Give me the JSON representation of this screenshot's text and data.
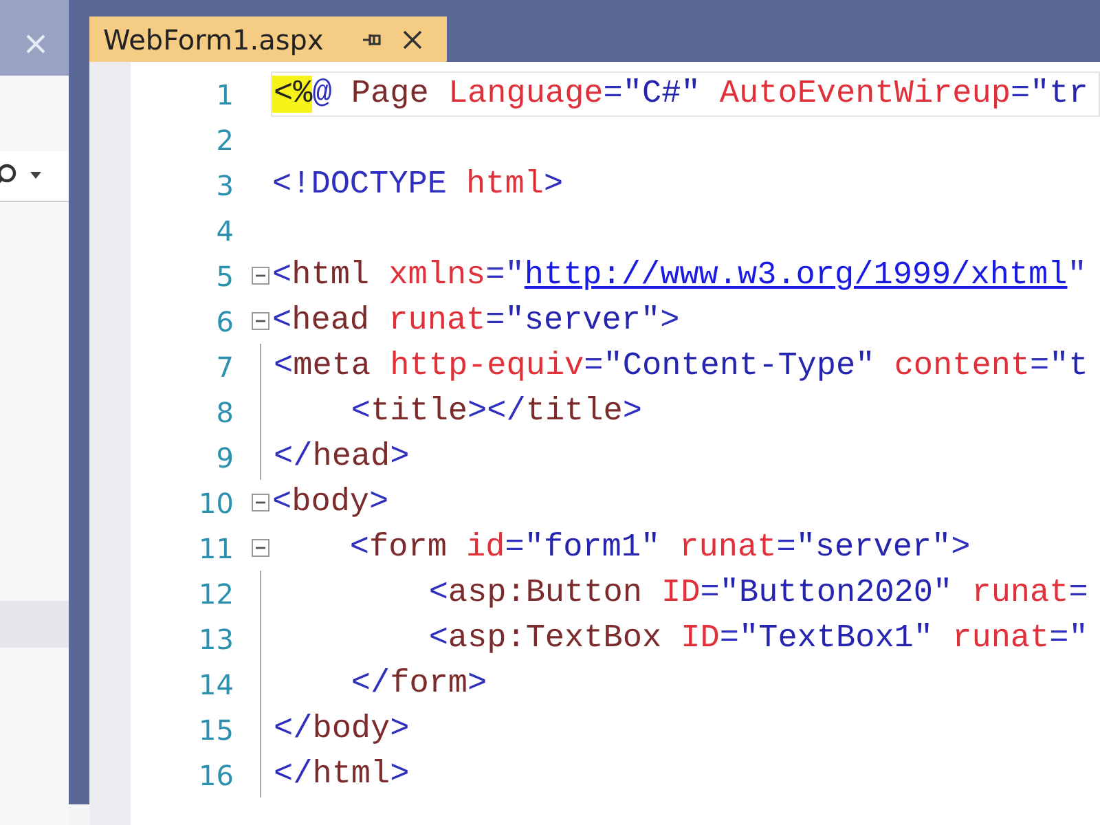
{
  "editor_tab": {
    "title": "WebForm1.aspx",
    "selected": true
  },
  "lines": [
    {
      "number": "1",
      "collapsible": false,
      "in_block": false,
      "current": true,
      "tokens": [
        {
          "text": "<%",
          "kind": "directive"
        },
        {
          "text": "@",
          "kind": "delim"
        },
        {
          "text": " Page ",
          "kind": "tag"
        },
        {
          "text": "Language",
          "kind": "attr"
        },
        {
          "text": "=",
          "kind": "delim"
        },
        {
          "text": "\"C#\"",
          "kind": "value"
        },
        {
          "text": " AutoEventWireup",
          "kind": "attr"
        },
        {
          "text": "=",
          "kind": "delim"
        },
        {
          "text": "\"tr",
          "kind": "value"
        }
      ]
    },
    {
      "number": "2",
      "collapsible": false,
      "in_block": false,
      "current": false
    },
    {
      "number": "3",
      "collapsible": false,
      "in_block": false,
      "current": false,
      "tokens": [
        {
          "text": "<!",
          "kind": "delim"
        },
        {
          "text": "DOCTYPE",
          "kind": "delim"
        },
        {
          "text": " html",
          "kind": "attr"
        },
        {
          "text": ">",
          "kind": "delim"
        }
      ]
    },
    {
      "number": "4",
      "collapsible": false,
      "in_block": false,
      "current": false
    },
    {
      "number": "5",
      "collapsible": true,
      "in_block": false,
      "current": false,
      "tokens": [
        {
          "text": "<",
          "kind": "delim"
        },
        {
          "text": "html",
          "kind": "tag"
        },
        {
          "text": " xmlns",
          "kind": "attr"
        },
        {
          "text": "=\"",
          "kind": "delim"
        },
        {
          "text": "http://www.w3.org/1999/xhtml",
          "kind": "link"
        },
        {
          "text": "\"",
          "kind": "delim"
        }
      ]
    },
    {
      "number": "6",
      "collapsible": true,
      "in_block": false,
      "current": false,
      "tokens": [
        {
          "text": "<",
          "kind": "delim"
        },
        {
          "text": "head",
          "kind": "tag"
        },
        {
          "text": " runat",
          "kind": "attr"
        },
        {
          "text": "=",
          "kind": "delim"
        },
        {
          "text": "\"server\"",
          "kind": "value"
        },
        {
          "text": ">",
          "kind": "delim"
        }
      ]
    },
    {
      "number": "7",
      "collapsible": false,
      "in_block": true,
      "current": false,
      "tokens": [
        {
          "text": "<",
          "kind": "delim"
        },
        {
          "text": "meta",
          "kind": "tag"
        },
        {
          "text": " http-equiv",
          "kind": "attr"
        },
        {
          "text": "=",
          "kind": "delim"
        },
        {
          "text": "\"Content-Type\"",
          "kind": "value"
        },
        {
          "text": " content",
          "kind": "attr"
        },
        {
          "text": "=",
          "kind": "delim"
        },
        {
          "text": "\"t",
          "kind": "value"
        }
      ]
    },
    {
      "number": "8",
      "collapsible": false,
      "in_block": true,
      "current": false,
      "tokens": [
        {
          "text": "    <",
          "kind": "delim"
        },
        {
          "text": "title",
          "kind": "tag"
        },
        {
          "text": "></",
          "kind": "delim"
        },
        {
          "text": "title",
          "kind": "tag"
        },
        {
          "text": ">",
          "kind": "delim"
        }
      ]
    },
    {
      "number": "9",
      "collapsible": false,
      "in_block": true,
      "current": false,
      "tokens": [
        {
          "text": "</",
          "kind": "delim"
        },
        {
          "text": "head",
          "kind": "tag"
        },
        {
          "text": ">",
          "kind": "delim"
        }
      ]
    },
    {
      "number": "10",
      "collapsible": true,
      "in_block": false,
      "current": false,
      "tokens": [
        {
          "text": "<",
          "kind": "delim"
        },
        {
          "text": "body",
          "kind": "tag"
        },
        {
          "text": ">",
          "kind": "delim"
        }
      ]
    },
    {
      "number": "11",
      "collapsible": true,
      "in_block": false,
      "current": false,
      "tokens": [
        {
          "text": "    <",
          "kind": "delim"
        },
        {
          "text": "form",
          "kind": "tag"
        },
        {
          "text": " id",
          "kind": "attr"
        },
        {
          "text": "=",
          "kind": "delim"
        },
        {
          "text": "\"form1\"",
          "kind": "value"
        },
        {
          "text": " runat",
          "kind": "attr"
        },
        {
          "text": "=",
          "kind": "delim"
        },
        {
          "text": "\"server\"",
          "kind": "value"
        },
        {
          "text": ">",
          "kind": "delim"
        }
      ]
    },
    {
      "number": "12",
      "collapsible": false,
      "in_block": true,
      "current": false,
      "tokens": [
        {
          "text": "        <",
          "kind": "delim"
        },
        {
          "text": "asp:Button",
          "kind": "tag"
        },
        {
          "text": " ID",
          "kind": "attr"
        },
        {
          "text": "=",
          "kind": "delim"
        },
        {
          "text": "\"Button2020\"",
          "kind": "value"
        },
        {
          "text": " runat",
          "kind": "attr"
        },
        {
          "text": "=",
          "kind": "delim"
        }
      ]
    },
    {
      "number": "13",
      "collapsible": false,
      "in_block": true,
      "current": false,
      "tokens": [
        {
          "text": "        <",
          "kind": "delim"
        },
        {
          "text": "asp:TextBox",
          "kind": "tag"
        },
        {
          "text": " ID",
          "kind": "attr"
        },
        {
          "text": "=",
          "kind": "delim"
        },
        {
          "text": "\"TextBox1\"",
          "kind": "value"
        },
        {
          "text": " runat",
          "kind": "attr"
        },
        {
          "text": "=\"",
          "kind": "delim"
        }
      ]
    },
    {
      "number": "14",
      "collapsible": false,
      "in_block": true,
      "current": false,
      "tokens": [
        {
          "text": "    </",
          "kind": "delim"
        },
        {
          "text": "form",
          "kind": "tag"
        },
        {
          "text": ">",
          "kind": "delim"
        }
      ]
    },
    {
      "number": "15",
      "collapsible": false,
      "in_block": true,
      "current": false,
      "tokens": [
        {
          "text": "</",
          "kind": "delim"
        },
        {
          "text": "body",
          "kind": "tag"
        },
        {
          "text": ">",
          "kind": "delim"
        }
      ]
    },
    {
      "number": "16",
      "collapsible": false,
      "in_block": true,
      "current": false,
      "tokens": [
        {
          "text": "</",
          "kind": "delim"
        },
        {
          "text": "html",
          "kind": "tag"
        },
        {
          "text": ">",
          "kind": "delim"
        }
      ]
    }
  ]
}
